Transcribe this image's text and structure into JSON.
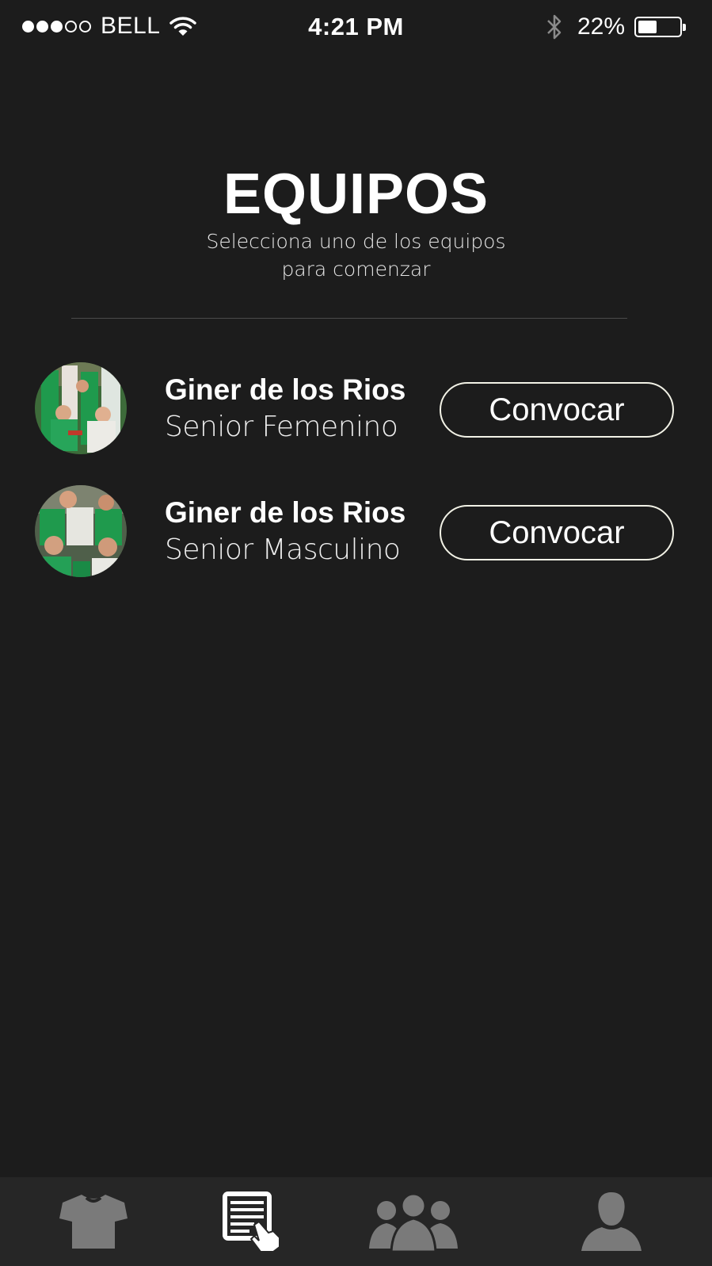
{
  "status_bar": {
    "signal": {
      "filled": 3,
      "total": 5
    },
    "carrier": "BELL",
    "time": "4:21 PM",
    "battery_percent_label": "22%",
    "battery_level": 0.22
  },
  "header": {
    "title": "EQUIPOS",
    "subtitle": "Selecciona uno de los equipos para comenzar"
  },
  "teams": [
    {
      "name": "Giner de los Rios",
      "category": "Senior Femenino",
      "action_label": "Convocar"
    },
    {
      "name": "Giner de los Rios",
      "category": "Senior Masculino",
      "action_label": "Convocar"
    }
  ],
  "tab_bar": {
    "tabs": [
      {
        "icon": "jersey-icon",
        "active": false
      },
      {
        "icon": "lineup-list-icon",
        "active": true
      },
      {
        "icon": "group-icon",
        "active": false
      },
      {
        "icon": "profile-icon",
        "active": false
      }
    ],
    "colors": {
      "active": "#ffffff",
      "inactive": "#7a7a7a"
    }
  },
  "colors": {
    "background": "#1c1c1c",
    "tab_bar_background": "#262626",
    "team_green": "#1f9a4d"
  }
}
